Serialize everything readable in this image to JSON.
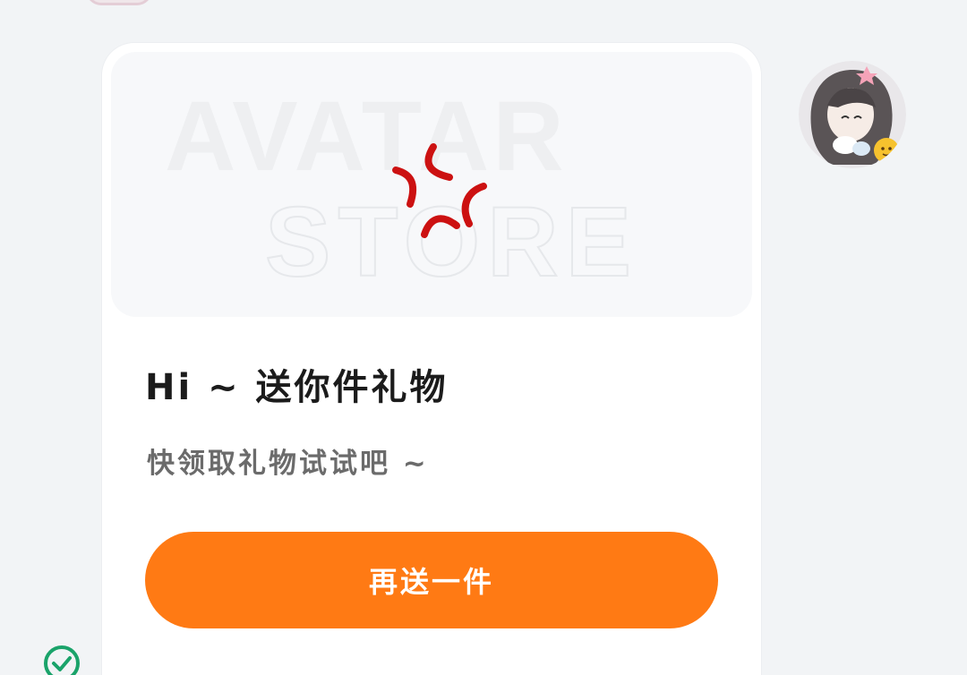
{
  "gift_card": {
    "banner": {
      "watermark_line1": "AVATAR",
      "watermark_line2": "STORE",
      "icon": "anger-symbol-icon"
    },
    "title": "Hi ~ 送你件礼物",
    "subtitle": "快领取礼物试试吧 ~",
    "button_label": "再送一件"
  },
  "sender": {
    "avatar": "avatar"
  },
  "status": {
    "icon": "check-circle-icon"
  },
  "colors": {
    "page_background": "#f2f4f6",
    "card_background": "#ffffff",
    "button": "#ff7a14",
    "anger_icon": "#cc1111",
    "check_icon": "#1aa36a"
  }
}
